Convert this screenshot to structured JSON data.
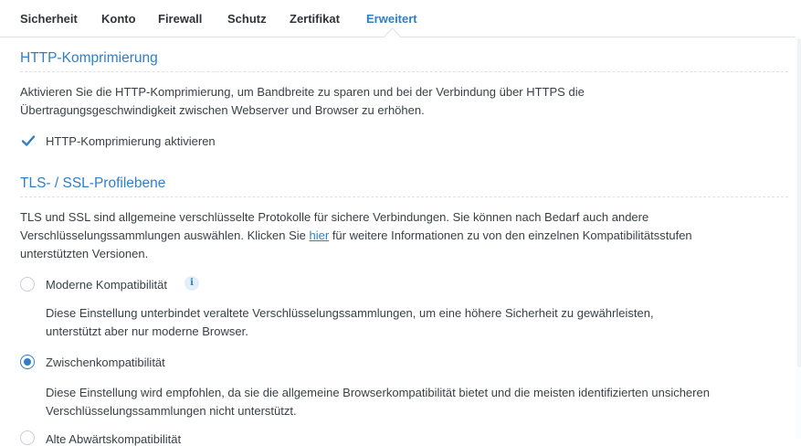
{
  "tabs": [
    "Sicherheit",
    "Konto",
    "Firewall",
    "Schutz",
    "Zertifikat",
    "Erweitert"
  ],
  "http": {
    "title": "HTTP-Komprimierung",
    "line1": "Aktivieren Sie die HTTP-Komprimierung, um Bandbreite zu sparen und bei der Verbindung über HTTPS die",
    "line2": "Übertragungsgeschwindigkeit zwischen Webserver und Browser zu erhöhen.",
    "checkbox_label": "HTTP-Komprimierung aktivieren",
    "checked": true
  },
  "tls": {
    "title": "TLS- / SSL-Profilebene",
    "line1": "TLS und SSL sind allgemeine verschlüsselte Protokolle für sichere Verbindungen. Sie können nach Bedarf auch andere",
    "line2_pre": "Verschlüsselungssammlungen auswählen. Klicken Sie ",
    "link": "hier",
    "line2_post": " für weitere Informationen zu von den einzelnen Kompatibilitätsstufen",
    "line3": "unterstützten Versionen.",
    "options": [
      {
        "label": "Moderne Kompatibilität",
        "desc1": "Diese Einstellung unterbindet veraltete Verschlüsselungssammlungen, um eine höhere Sicherheit zu gewährleisten,",
        "desc2": "unterstützt aber nur moderne Browser.",
        "info_icon": "i",
        "selected": false
      },
      {
        "label": "Zwischenkompatibilität",
        "desc1": "Diese Einstellung wird empfohlen, da sie die allgemeine Browserkompatibilität bietet und die meisten identifizierten unsicheren",
        "desc2": "Verschlüsselungssammlungen nicht unterstützt.",
        "selected": true
      },
      {
        "label": "Alte Abwärtskompatibilität",
        "selected": false
      }
    ]
  },
  "colors": {
    "accent": "#2f7fc8",
    "text": "#3a3f45"
  }
}
